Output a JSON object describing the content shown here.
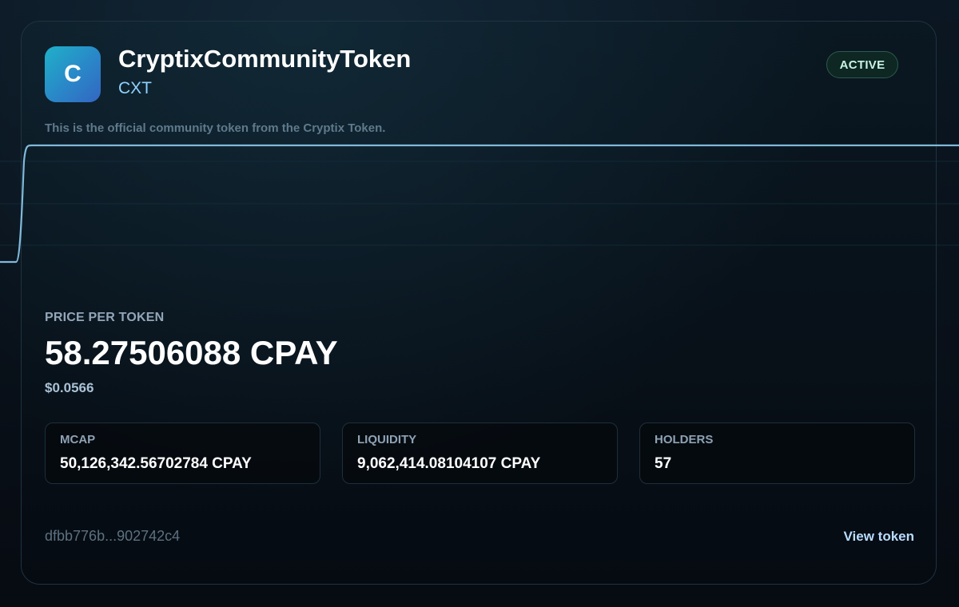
{
  "token": {
    "logo_letter": "C",
    "name": "CryptixCommunityToken",
    "symbol": "CXT",
    "status": "ACTIVE",
    "description": "This is the official community token from the Cryptix Token."
  },
  "price": {
    "label": "PRICE PER TOKEN",
    "value": "58.27506088 CPAY",
    "usd": "$0.0566"
  },
  "stats": [
    {
      "label": "MCAP",
      "value": "50,126,342.56702784 CPAY"
    },
    {
      "label": "LIQUIDITY",
      "value": "9,062,414.08104107 CPAY"
    },
    {
      "label": "HOLDERS",
      "value": "57"
    }
  ],
  "footer": {
    "address": "dfbb776b...902742c4",
    "view_label": "View token"
  },
  "colors": {
    "accent": "#8fd2ff",
    "line": "#7fb9d9",
    "badge_bg": "#0e2723",
    "badge_text": "#c8f3e3"
  },
  "chart_data": {
    "type": "line",
    "series": [
      {
        "values": [
          0.0,
          0.0,
          1.0,
          1.0,
          1.0,
          1.0,
          1.0,
          1.0,
          1.0,
          1.0,
          1.0
        ]
      }
    ],
    "grid": true
  }
}
